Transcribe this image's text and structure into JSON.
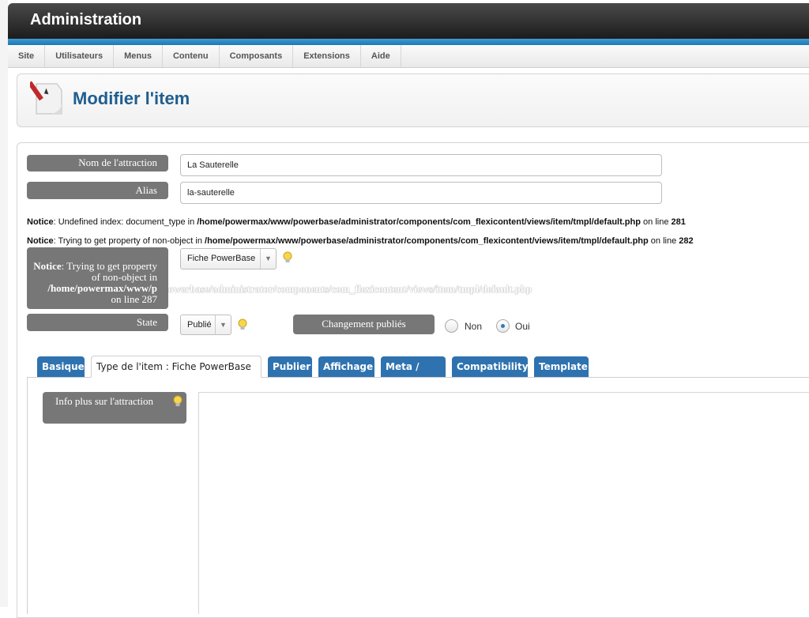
{
  "app": {
    "title": "Administration"
  },
  "menu": {
    "items": [
      "Site",
      "Utilisateurs",
      "Menus",
      "Contenu",
      "Composants",
      "Extensions",
      "Aide"
    ]
  },
  "page": {
    "title": "Modifier l'item"
  },
  "form": {
    "name_label": "Nom de l'attraction",
    "name_value": "La Sauterelle",
    "alias_label": "Alias",
    "alias_value": "la-sauterelle",
    "notice1": {
      "prefix": "Notice",
      "text": ": Undefined index: document_type in ",
      "path": "/home/powermax/www/powerbase/administrator/components/com_flexicontent/views/item/tmpl/default.php",
      "online": " on line ",
      "line": "281"
    },
    "notice2": {
      "prefix": "Notice",
      "text": ": Trying to get property of non-object in ",
      "path": "/home/powermax/www/powerbase/administrator/components/com_flexicontent/views/item/tmpl/default.php",
      "online": " on line ",
      "line": "282"
    },
    "type_label_notice": "Notice",
    "type_label_text": ": Trying to get property of non-object in",
    "type_label_path": "/home/powermax/www/p",
    "type_label_overflow": "owerbase/administrator/components/com_flexicontent/views/item/tmpl/default.php",
    "type_label_line": "on line 287",
    "type_select": "Fiche PowerBase",
    "state_label": "State",
    "state_select": "Publié",
    "change_label": "Changement publiés",
    "radio_no": "Non",
    "radio_yes": "Oui"
  },
  "tabs": [
    {
      "label": "Basique"
    },
    {
      "label": "Type de l'item : Fiche PowerBase"
    },
    {
      "label": "Publier"
    },
    {
      "label": "Affichage"
    },
    {
      "label": "Meta / SEO"
    },
    {
      "label": "Compatibility"
    },
    {
      "label": "Template"
    }
  ],
  "panel": {
    "info_label": "Info plus sur l'attraction"
  },
  "colors": {
    "tab_blue": "#2e73b0",
    "label_grey": "#777777",
    "header_dark": "#1c1c1c",
    "title_blue": "#1f5e8f"
  }
}
